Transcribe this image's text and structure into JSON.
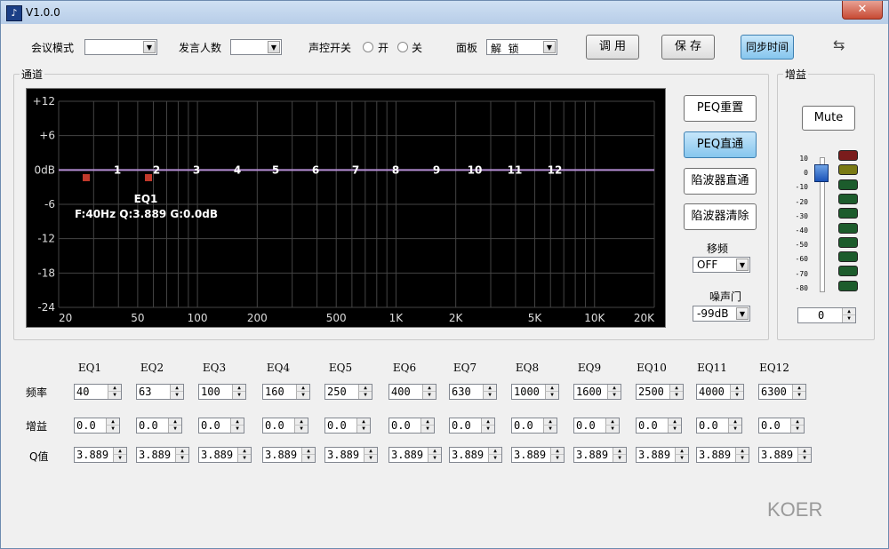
{
  "window": {
    "title": "V1.0.0",
    "close_label": "✕"
  },
  "toolbar": {
    "meeting_mode_label": "会议模式",
    "meeting_mode_value": "",
    "speaker_count_label": "发言人数",
    "speaker_count_value": "",
    "voice_switch_label": "声控开关",
    "voice_on_label": "开",
    "voice_off_label": "关",
    "panel_label": "面板",
    "panel_value": "解  锁",
    "apply_label": "调 用",
    "save_label": "保 存",
    "sync_time_label": "同步时间"
  },
  "channel": {
    "group_title": "通道",
    "graph": {
      "y_labels": [
        "+12",
        "+6",
        "0dB",
        "-6",
        "-12",
        "-18",
        "-24"
      ],
      "x_labels": [
        "20",
        "50",
        "100",
        "200",
        "500",
        "1K",
        "2K",
        "5K",
        "10K",
        "20K"
      ],
      "band_labels": [
        "1",
        "2",
        "3",
        "4",
        "5",
        "6",
        "7",
        "8",
        "9",
        "10",
        "11",
        "12"
      ],
      "selected_eq_name": "EQ1",
      "selected_eq_info": "F:40Hz  Q:3.889  G:0.0dB",
      "curve_color": "#b78fd6",
      "marker_color": "#c0392b"
    },
    "buttons": {
      "peq_reset": "PEQ重置",
      "peq_bypass": "PEQ直通",
      "notch_bypass": "陷波器直通",
      "notch_clear": "陷波器清除"
    },
    "shift_label": "移频",
    "shift_value": "OFF",
    "noise_gate_label": "噪声门",
    "noise_gate_value": "-99dB"
  },
  "gain": {
    "group_title": "增益",
    "mute_label": "Mute",
    "scale": [
      "10",
      "0",
      "-10",
      "-20",
      "-30",
      "-40",
      "-50",
      "-60",
      "-70",
      "-80"
    ],
    "value": "0",
    "led_colors": [
      "#7a1c1c",
      "#7a7a14",
      "#1c5c2c",
      "#1c5c2c",
      "#1c5c2c",
      "#1c5c2c",
      "#1c5c2c",
      "#1c5c2c",
      "#1c5c2c",
      "#1c5c2c"
    ]
  },
  "eq": {
    "row_labels": {
      "freq": "频率",
      "gain": "增益",
      "q": "Q值"
    },
    "bands": [
      {
        "name": "EQ1",
        "freq": "40",
        "gain": "0.0",
        "q": "3.889"
      },
      {
        "name": "EQ2",
        "freq": "63",
        "gain": "0.0",
        "q": "3.889"
      },
      {
        "name": "EQ3",
        "freq": "100",
        "gain": "0.0",
        "q": "3.889"
      },
      {
        "name": "EQ4",
        "freq": "160",
        "gain": "0.0",
        "q": "3.889"
      },
      {
        "name": "EQ5",
        "freq": "250",
        "gain": "0.0",
        "q": "3.889"
      },
      {
        "name": "EQ6",
        "freq": "400",
        "gain": "0.0",
        "q": "3.889"
      },
      {
        "name": "EQ7",
        "freq": "630",
        "gain": "0.0",
        "q": "3.889"
      },
      {
        "name": "EQ8",
        "freq": "1000",
        "gain": "0.0",
        "q": "3.889"
      },
      {
        "name": "EQ9",
        "freq": "1600",
        "gain": "0.0",
        "q": "3.889"
      },
      {
        "name": "EQ10",
        "freq": "2500",
        "gain": "0.0",
        "q": "3.889"
      },
      {
        "name": "EQ11",
        "freq": "4000",
        "gain": "0.0",
        "q": "3.889"
      },
      {
        "name": "EQ12",
        "freq": "6300",
        "gain": "0.0",
        "q": "3.889"
      }
    ]
  },
  "watermark": "KOER"
}
